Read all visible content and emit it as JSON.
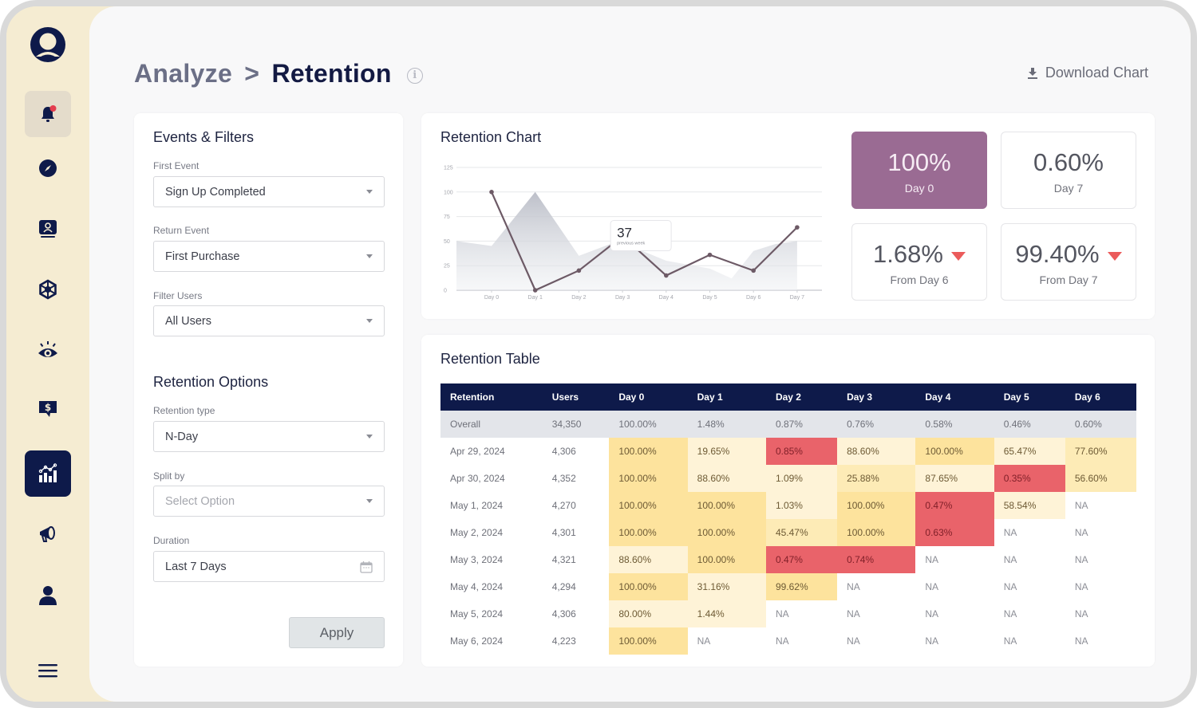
{
  "sidebar": {
    "logo": "user-avatar-logo",
    "items": [
      {
        "name": "notifications",
        "icon": "bell-icon",
        "state": "hover",
        "has_badge": true
      },
      {
        "name": "explore",
        "icon": "compass-icon"
      },
      {
        "name": "profiles",
        "icon": "profile-card-icon"
      },
      {
        "name": "integrations",
        "icon": "network-icon"
      },
      {
        "name": "monitor",
        "icon": "eye-icon"
      },
      {
        "name": "revenue",
        "icon": "dollar-chat-icon"
      },
      {
        "name": "analyze",
        "icon": "analytics-chart-icon",
        "state": "active"
      },
      {
        "name": "campaigns",
        "icon": "megaphone-icon"
      },
      {
        "name": "users",
        "icon": "person-icon"
      },
      {
        "name": "menu",
        "icon": "hamburger-menu-icon"
      }
    ]
  },
  "header": {
    "breadcrumb_parent": "Analyze",
    "breadcrumb_separator": ">",
    "breadcrumb_current": "Retention",
    "info_icon": "i",
    "download_label": "Download Chart"
  },
  "filters": {
    "events_title": "Events & Filters",
    "first_event_label": "First Event",
    "first_event_value": "Sign Up Completed",
    "return_event_label": "Return Event",
    "return_event_value": "First Purchase",
    "filter_users_label": "Filter Users",
    "filter_users_value": "All Users",
    "options_title": "Retention Options",
    "retention_type_label": "Retention type",
    "retention_type_value": "N-Day",
    "split_by_label": "Split by",
    "split_by_placeholder": "Select Option",
    "duration_label": "Duration",
    "duration_value": "Last 7 Days",
    "apply_label": "Apply"
  },
  "chart_card": {
    "title": "Retention Chart",
    "tooltip_value": "37",
    "tooltip_label": "previous week"
  },
  "chart_data": {
    "type": "line",
    "title": "Retention Chart",
    "xlabel": "",
    "ylabel": "",
    "x": [
      "Day 0",
      "Day 1",
      "Day 2",
      "Day 3",
      "Day 4",
      "Day 5",
      "Day 6",
      "Day 7"
    ],
    "yticks": [
      0,
      25,
      50,
      75,
      100,
      125
    ],
    "ylim": [
      0,
      125
    ],
    "grid": true,
    "series": [
      {
        "name": "current",
        "kind": "line",
        "values": [
          100,
          0,
          20,
          55,
          15,
          36,
          20,
          64
        ]
      },
      {
        "name": "previous week",
        "kind": "area",
        "x_pos": [
          -2.4,
          0,
          1,
          2,
          2.9,
          4,
          5,
          5.5,
          6,
          6.5,
          7
        ],
        "values": [
          50,
          45,
          100,
          35,
          50,
          30,
          22,
          12,
          40,
          47,
          50
        ]
      }
    ],
    "tooltip": {
      "x": "Day 3",
      "value": 37,
      "label": "previous week"
    }
  },
  "stats": [
    {
      "value": "100%",
      "label": "Day 0",
      "trend": null,
      "highlight": true
    },
    {
      "value": "0.60%",
      "label": "Day 7",
      "trend": null,
      "highlight": false
    },
    {
      "value": "1.68%",
      "label": "From Day 6",
      "trend": "down",
      "highlight": false
    },
    {
      "value": "99.40%",
      "label": "From Day 7",
      "trend": "down",
      "highlight": false
    }
  ],
  "table": {
    "title": "Retention Table",
    "columns": [
      "Retention",
      "Users",
      "Day 0",
      "Day 1",
      "Day 2",
      "Day 3",
      "Day 4",
      "Day 5",
      "Day 6"
    ],
    "overall": [
      "Overall",
      "34,350",
      "100.00%",
      "1.48%",
      "0.87%",
      "0.76%",
      "0.58%",
      "0.46%",
      "0.60%"
    ],
    "rows": [
      {
        "cells": [
          "Apr 29, 2024",
          "4,306",
          "100.00%",
          "19.65%",
          "0.85%",
          "88.60%",
          "100.00%",
          "65.47%",
          "77.60%"
        ],
        "heat": [
          "hi",
          "lo",
          "red",
          "lo",
          "hi",
          "lo",
          "mid"
        ]
      },
      {
        "cells": [
          "Apr 30, 2024",
          "4,352",
          "100.00%",
          "88.60%",
          "1.09%",
          "25.88%",
          "87.65%",
          "0.35%",
          "56.60%"
        ],
        "heat": [
          "hi",
          "lo",
          "lo",
          "mid",
          "lo",
          "red",
          "mid"
        ]
      },
      {
        "cells": [
          "May 1, 2024",
          "4,270",
          "100.00%",
          "100.00%",
          "1.03%",
          "100.00%",
          "0.47%",
          "58.54%",
          "NA"
        ],
        "heat": [
          "hi",
          "hi",
          "lo",
          "hi",
          "red",
          "lo",
          "na"
        ]
      },
      {
        "cells": [
          "May 2, 2024",
          "4,301",
          "100.00%",
          "100.00%",
          "45.47%",
          "100.00%",
          "0.63%",
          "NA",
          "NA"
        ],
        "heat": [
          "hi",
          "hi",
          "mid",
          "hi",
          "red",
          "na",
          "na"
        ]
      },
      {
        "cells": [
          "May 3, 2024",
          "4,321",
          "88.60%",
          "100.00%",
          "0.47%",
          "0.74%",
          "NA",
          "NA",
          "NA"
        ],
        "heat": [
          "lo",
          "hi",
          "red",
          "red",
          "na",
          "na",
          "na"
        ]
      },
      {
        "cells": [
          "May 4, 2024",
          "4,294",
          "100.00%",
          "31.16%",
          "99.62%",
          "NA",
          "NA",
          "NA",
          "NA"
        ],
        "heat": [
          "hi",
          "lo",
          "hi",
          "na",
          "na",
          "na",
          "na"
        ]
      },
      {
        "cells": [
          "May 5, 2024",
          "4,306",
          "80.00%",
          "1.44%",
          "NA",
          "NA",
          "NA",
          "NA",
          "NA"
        ],
        "heat": [
          "lo",
          "lo",
          "na",
          "na",
          "na",
          "na",
          "na"
        ]
      },
      {
        "cells": [
          "May 6, 2024",
          "4,223",
          "100.00%",
          "NA",
          "NA",
          "NA",
          "NA",
          "NA",
          "NA"
        ],
        "heat": [
          "hi",
          "na",
          "na",
          "na",
          "na",
          "na",
          "na"
        ]
      }
    ]
  },
  "colors": {
    "sidebar_bg": "#f5ecd2",
    "navy": "#0e1a4a",
    "accent_purple": "#9a6b93",
    "down_red": "#eb5b5b",
    "heat_high": "#fde39d",
    "heat_low": "#fef3d7",
    "heat_red": "#e9636a",
    "chart_line": "#6d5a66"
  }
}
